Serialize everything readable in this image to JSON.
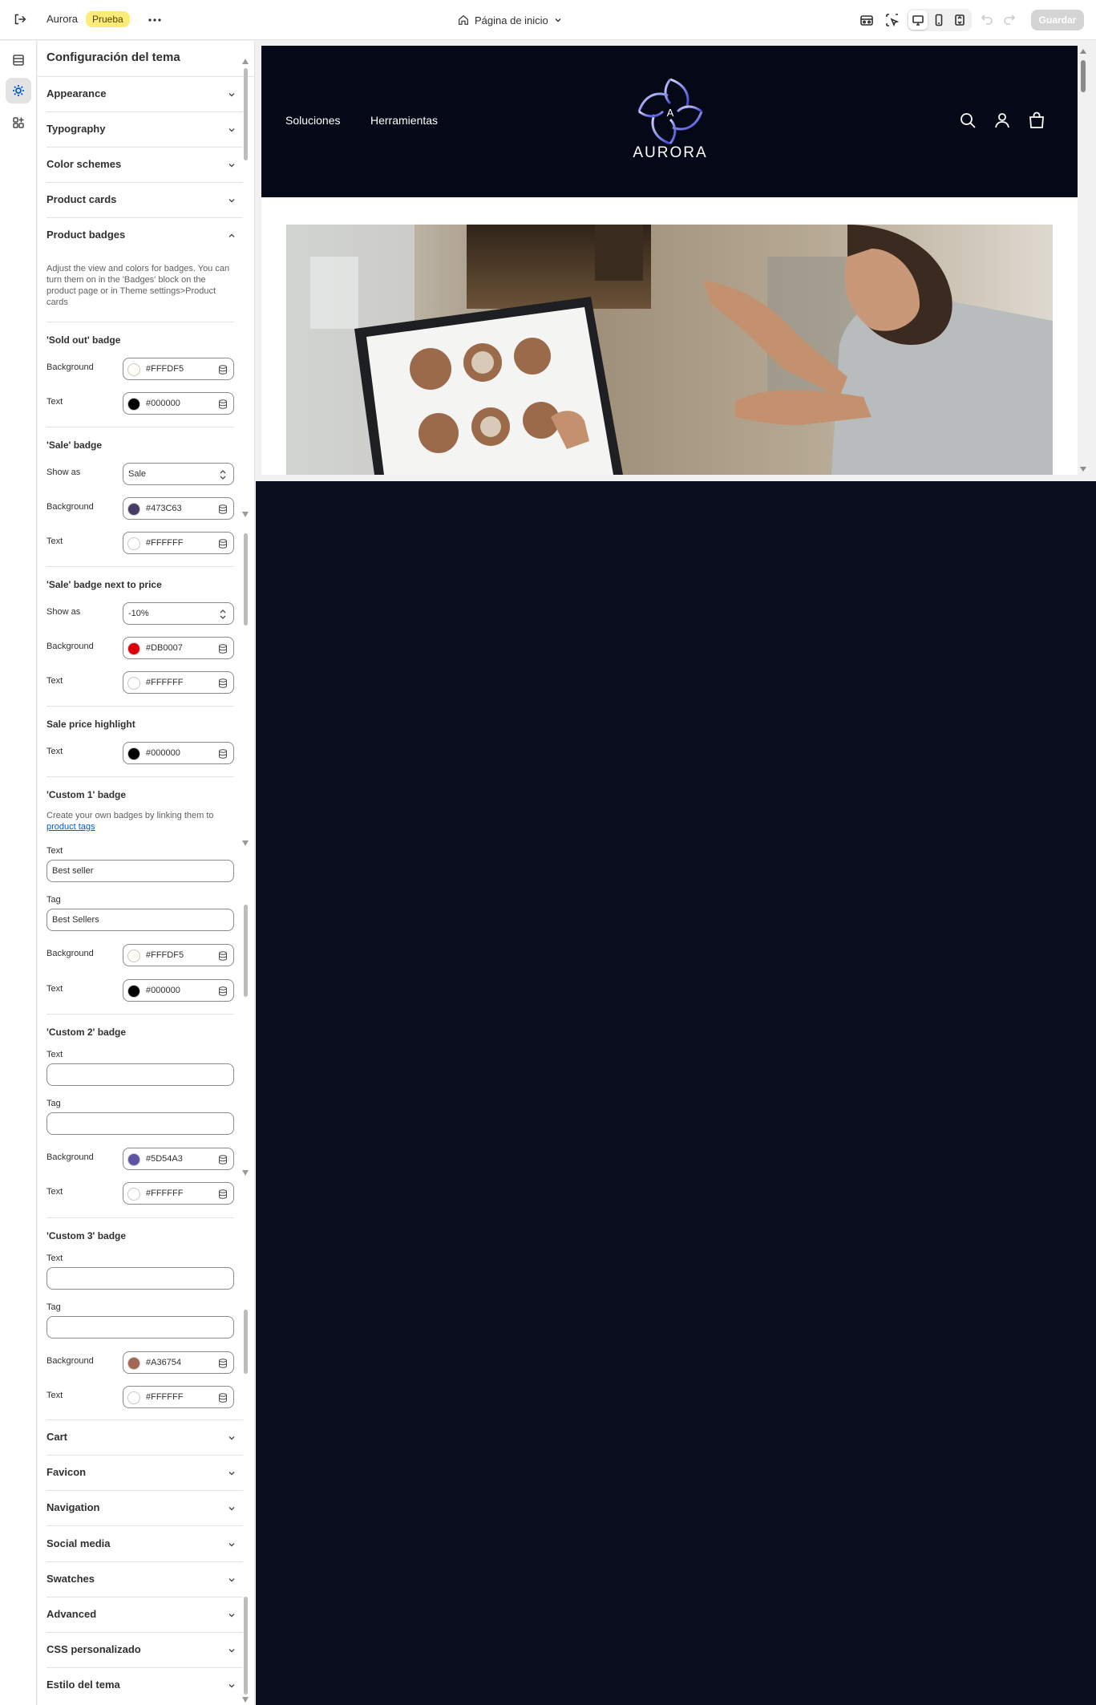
{
  "topbar": {
    "store_name": "Aurora",
    "badge": "Prueba",
    "page_selector": "Página de inicio",
    "save_label": "Guardar"
  },
  "panel": {
    "title": "Configuración del tema",
    "sections_top": [
      {
        "label": "Appearance"
      },
      {
        "label": "Typography"
      },
      {
        "label": "Color schemes"
      },
      {
        "label": "Product cards"
      }
    ],
    "product_badges": {
      "label": "Product badges",
      "description": "Adjust the view and colors for badges. You can turn them on in the 'Badges' block on the product page or in Theme settings>Product cards",
      "sold_out": {
        "title": "'Sold out' badge",
        "background_label": "Background",
        "background": "#FFFDF5",
        "text_label": "Text",
        "text": "#000000"
      },
      "sale": {
        "title": "'Sale' badge",
        "show_as_label": "Show as",
        "show_as": "Sale",
        "background_label": "Background",
        "background": "#473C63",
        "text_label": "Text",
        "text": "#FFFFFF"
      },
      "sale_next_to_price": {
        "title": "'Sale' badge next to price",
        "show_as_label": "Show as",
        "show_as": "-10%",
        "background_label": "Background",
        "background": "#DB0007",
        "text_label": "Text",
        "text": "#FFFFFF"
      },
      "sale_price_highlight": {
        "title": "Sale price highlight",
        "text_label": "Text",
        "text": "#000000"
      },
      "custom1": {
        "title": "'Custom 1' badge",
        "desc_prefix": "Create your own badges by linking them to",
        "desc_link": "product tags",
        "text_field_label": "Text",
        "text_value": "Best seller",
        "tag_field_label": "Tag",
        "tag_value": "Best Sellers",
        "background_label": "Background",
        "background": "#FFFDF5",
        "text_label": "Text",
        "text": "#000000"
      },
      "custom2": {
        "title": "'Custom 2' badge",
        "text_field_label": "Text",
        "text_value": "",
        "tag_field_label": "Tag",
        "tag_value": "",
        "background_label": "Background",
        "background": "#5D54A3",
        "text_label": "Text",
        "text": "#FFFFFF"
      },
      "custom3": {
        "title": "'Custom 3' badge",
        "text_field_label": "Text",
        "text_value": "",
        "tag_field_label": "Tag",
        "tag_value": "",
        "background_label": "Background",
        "background": "#A36754",
        "text_label": "Text",
        "text": "#FFFFFF"
      }
    },
    "sections_bottom": [
      {
        "label": "Cart"
      },
      {
        "label": "Favicon"
      },
      {
        "label": "Navigation"
      },
      {
        "label": "Social media"
      },
      {
        "label": "Swatches"
      },
      {
        "label": "Advanced"
      },
      {
        "label": "CSS personalizado"
      },
      {
        "label": "Estilo del tema"
      }
    ]
  },
  "preview": {
    "nav": [
      "Soluciones",
      "Herramientas"
    ],
    "logo_text": "AURORA",
    "header_bg": "#040817",
    "page_bg": "#0A0E1E"
  },
  "icons": [
    "exit-icon",
    "more-icon",
    "home-icon",
    "chevron-down-icon",
    "store-icon",
    "inspector-icon",
    "desktop-icon",
    "mobile-icon",
    "fullscreen-icon",
    "undo-icon",
    "redo-icon",
    "sections-icon",
    "theme-settings-icon",
    "apps-icon",
    "search-icon",
    "account-icon",
    "cart-icon",
    "color-stack-icon"
  ]
}
